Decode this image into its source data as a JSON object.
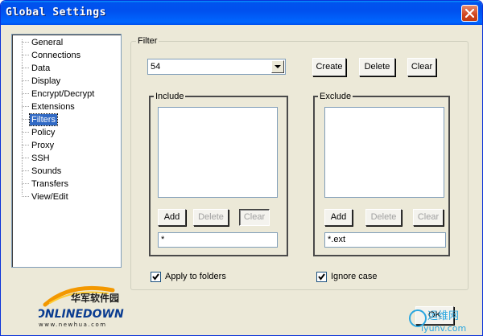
{
  "window": {
    "title": "Global Settings"
  },
  "sidebar": {
    "items": [
      {
        "label": "General"
      },
      {
        "label": "Connections"
      },
      {
        "label": "Data"
      },
      {
        "label": "Display"
      },
      {
        "label": "Encrypt/Decrypt"
      },
      {
        "label": "Extensions"
      },
      {
        "label": "Filters",
        "selected": true
      },
      {
        "label": "Policy"
      },
      {
        "label": "Proxy"
      },
      {
        "label": "SSH"
      },
      {
        "label": "Sounds"
      },
      {
        "label": "Transfers"
      },
      {
        "label": "View/Edit"
      }
    ]
  },
  "filter": {
    "group_label": "Filter",
    "selected": "54",
    "create_label": "Create",
    "delete_label": "Delete",
    "clear_label": "Clear"
  },
  "include": {
    "group_label": "Include",
    "add_label": "Add",
    "delete_label": "Delete",
    "clear_label": "Clear",
    "input_value": "*"
  },
  "exclude": {
    "group_label": "Exclude",
    "add_label": "Add",
    "delete_label": "Delete",
    "clear_label": "Clear",
    "input_value": "*.ext"
  },
  "options": {
    "apply_to_folders_label": "Apply to folders",
    "apply_to_folders_checked": true,
    "ignore_case_label": "Ignore case",
    "ignore_case_checked": true
  },
  "footer": {
    "ok_label": "OK"
  },
  "logo": {
    "cn_text": "华军软件园",
    "brand": "ONLINEDOWN",
    "url": "www.newhua.com"
  },
  "watermark": {
    "cn_text": "运维网",
    "url": "iyunv.com"
  },
  "colors": {
    "titlebar": "#0053ee",
    "selection": "#316ac5",
    "face": "#ece9d8"
  }
}
